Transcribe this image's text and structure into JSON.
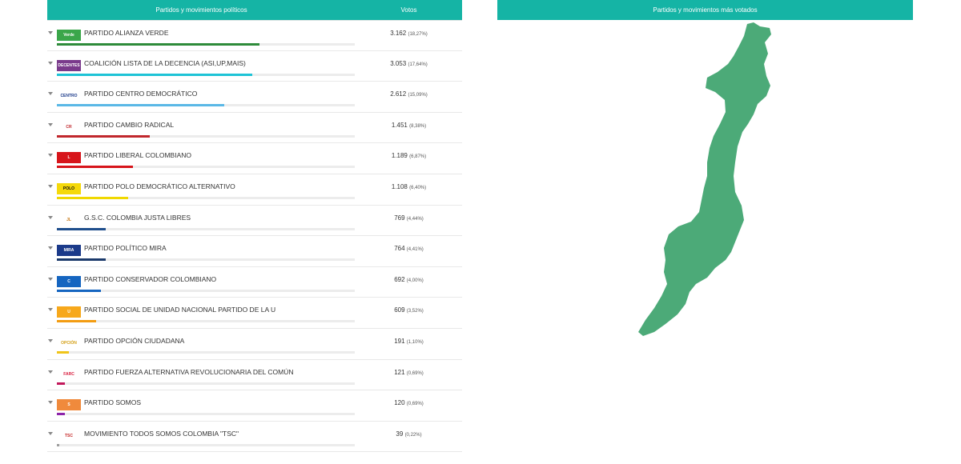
{
  "table": {
    "header_parties": "Partidos y movimientos políticos",
    "header_votes": "Votos",
    "rows": [
      {
        "name": "PARTIDO ALIANZA VERDE",
        "votes": "3.162",
        "pct": "(18,27%)",
        "share": 0.1827,
        "color": "#2e8b3a",
        "logo_text": "Verde",
        "logo_bg": "#3aa64a",
        "logo_fg": "#ffffff",
        "logo_icon": "alianza-verde-logo-icon"
      },
      {
        "name": "COALICIÓN LISTA DE LA DECENCIA (ASI,UP,MAIS)",
        "votes": "3.053",
        "pct": "(17,64%)",
        "share": 0.1764,
        "color": "#1ec3d6",
        "logo_text": "DECENTES",
        "logo_bg": "#7a3a8c",
        "logo_fg": "#ffffff",
        "logo_icon": "decentes-logo-icon"
      },
      {
        "name": "PARTIDO CENTRO DEMOCRÁTICO",
        "votes": "2.612",
        "pct": "(15,09%)",
        "share": 0.1509,
        "color": "#5ab8e6",
        "logo_text": "CENTRO",
        "logo_bg": "#ffffff",
        "logo_fg": "#1b3a8a",
        "logo_icon": "centro-democratico-logo-icon"
      },
      {
        "name": "PARTIDO CAMBIO RADICAL",
        "votes": "1.451",
        "pct": "(8,38%)",
        "share": 0.0838,
        "color": "#c1272d",
        "logo_text": "CR",
        "logo_bg": "#ffffff",
        "logo_fg": "#c1272d",
        "logo_icon": "cambio-radical-logo-icon"
      },
      {
        "name": "PARTIDO LIBERAL COLOMBIANO",
        "votes": "1.189",
        "pct": "(6,87%)",
        "share": 0.0687,
        "color": "#d7141a",
        "logo_text": "L",
        "logo_bg": "#d7141a",
        "logo_fg": "#ffffff",
        "logo_icon": "liberal-logo-icon"
      },
      {
        "name": "PARTIDO POLO DEMOCRÁTICO ALTERNATIVO",
        "votes": "1.108",
        "pct": "(6,40%)",
        "share": 0.064,
        "color": "#f0d800",
        "logo_text": "POLO",
        "logo_bg": "#f5d90a",
        "logo_fg": "#111111",
        "logo_icon": "polo-logo-icon"
      },
      {
        "name": "G.S.C. COLOMBIA JUSTA LIBRES",
        "votes": "769",
        "pct": "(4,44%)",
        "share": 0.0444,
        "color": "#1f4e8c",
        "logo_text": "JL",
        "logo_bg": "#ffffff",
        "logo_fg": "#c77b1a",
        "logo_icon": "colombia-justa-libres-logo-icon"
      },
      {
        "name": "PARTIDO POLÍTICO MIRA",
        "votes": "764",
        "pct": "(4,41%)",
        "share": 0.0441,
        "color": "#1b3a6b",
        "logo_text": "MIRA",
        "logo_bg": "#1b3a8a",
        "logo_fg": "#ffffff",
        "logo_icon": "mira-logo-icon"
      },
      {
        "name": "PARTIDO CONSERVADOR COLOMBIANO",
        "votes": "692",
        "pct": "(4,00%)",
        "share": 0.04,
        "color": "#1565c0",
        "logo_text": "C",
        "logo_bg": "#1565c0",
        "logo_fg": "#ffffff",
        "logo_icon": "conservador-logo-icon"
      },
      {
        "name": "PARTIDO SOCIAL DE UNIDAD NACIONAL PARTIDO DE LA U",
        "votes": "609",
        "pct": "(3,52%)",
        "share": 0.0352,
        "color": "#f39c12",
        "logo_text": "U",
        "logo_bg": "#f7a81b",
        "logo_fg": "#ffffff",
        "logo_icon": "partido-de-la-u-logo-icon"
      },
      {
        "name": "PARTIDO OPCIÓN CIUDADANA",
        "votes": "191",
        "pct": "(1,10%)",
        "share": 0.011,
        "color": "#f0c419",
        "logo_text": "OPCIÓN",
        "logo_bg": "#ffffff",
        "logo_fg": "#d4a017",
        "logo_icon": "opcion-ciudadana-logo-icon"
      },
      {
        "name": "PARTIDO FUERZA ALTERNATIVA REVOLUCIONARIA DEL COMÚN",
        "votes": "121",
        "pct": "(0,69%)",
        "share": 0.0069,
        "color": "#c2185b",
        "logo_text": "FARC",
        "logo_bg": "#ffffff",
        "logo_fg": "#d81b3c",
        "logo_icon": "farc-logo-icon"
      },
      {
        "name": "PARTIDO SOMOS",
        "votes": "120",
        "pct": "(0,69%)",
        "share": 0.0069,
        "color": "#8e24aa",
        "logo_text": "S",
        "logo_bg": "#f08a3c",
        "logo_fg": "#ffffff",
        "logo_icon": "somos-logo-icon"
      },
      {
        "name": "MOVIMIENTO TODOS SOMOS COLOMBIA \"TSC\"",
        "votes": "39",
        "pct": "(0,22%)",
        "share": 0.0022,
        "color": "#9e9e9e",
        "logo_text": "TSC",
        "logo_bg": "#ffffff",
        "logo_fg": "#c62828",
        "logo_icon": "tsc-logo-icon"
      }
    ]
  },
  "map": {
    "header": "Partidos y movimientos más votados",
    "fill_color": "#4caa78",
    "region_icon": "department-map-shape"
  }
}
